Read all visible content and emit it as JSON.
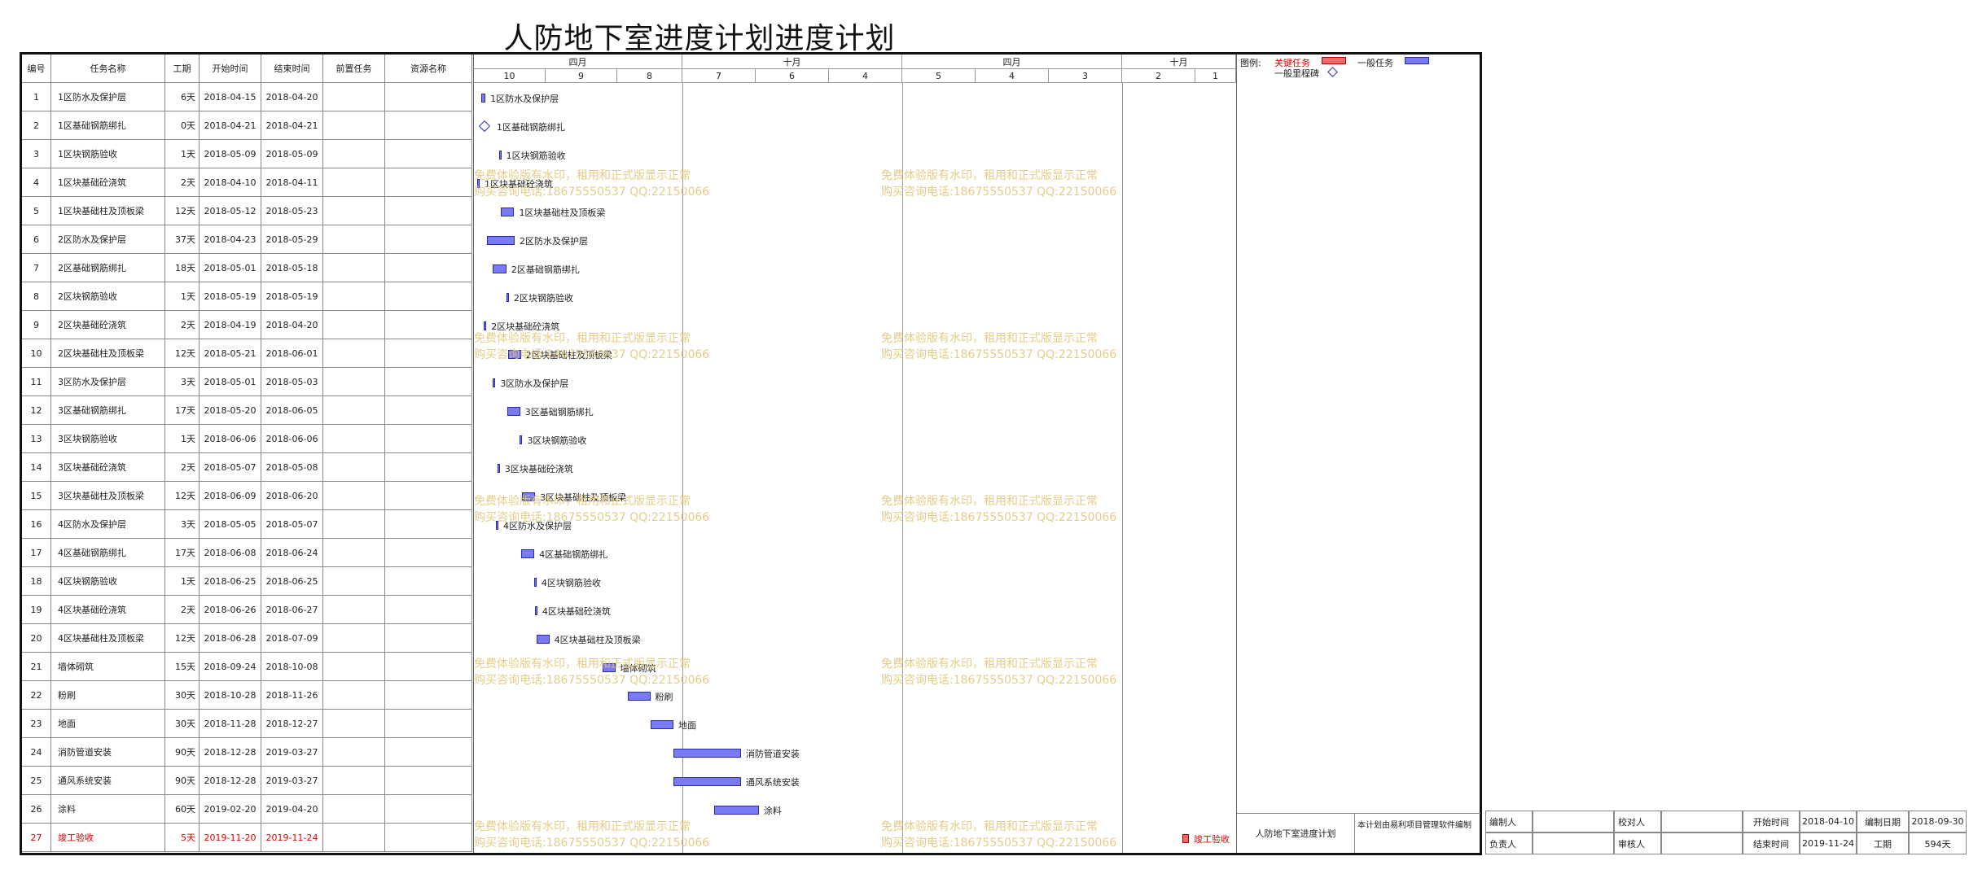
{
  "title": "人防地下室进度计划进度计划",
  "table": {
    "headers": {
      "id": "编号",
      "name": "任务名称",
      "duration": "工期",
      "start": "开始时间",
      "end": "结束时间",
      "predecessor": "前置任务",
      "resource": "资源名称"
    },
    "rows": [
      {
        "id": "1",
        "name": "1区防水及保护层",
        "duration": "6天",
        "start": "2018-04-15",
        "end": "2018-04-20"
      },
      {
        "id": "2",
        "name": "1区基础钢筋绑扎",
        "duration": "0天",
        "start": "2018-04-21",
        "end": "2018-04-21"
      },
      {
        "id": "3",
        "name": "1区块钢筋验收",
        "duration": "1天",
        "start": "2018-05-09",
        "end": "2018-05-09"
      },
      {
        "id": "4",
        "name": "1区块基础砼浇筑",
        "duration": "2天",
        "start": "2018-04-10",
        "end": "2018-04-11"
      },
      {
        "id": "5",
        "name": "1区块基础柱及顶板梁",
        "duration": "12天",
        "start": "2018-05-12",
        "end": "2018-05-23"
      },
      {
        "id": "6",
        "name": "2区防水及保护层",
        "duration": "37天",
        "start": "2018-04-23",
        "end": "2018-05-29"
      },
      {
        "id": "7",
        "name": "2区基础钢筋绑扎",
        "duration": "18天",
        "start": "2018-05-01",
        "end": "2018-05-18"
      },
      {
        "id": "8",
        "name": "2区块钢筋验收",
        "duration": "1天",
        "start": "2018-05-19",
        "end": "2018-05-19"
      },
      {
        "id": "9",
        "name": "2区块基础砼浇筑",
        "duration": "2天",
        "start": "2018-04-19",
        "end": "2018-04-20"
      },
      {
        "id": "10",
        "name": "2区块基础柱及顶板梁",
        "duration": "12天",
        "start": "2018-05-21",
        "end": "2018-06-01"
      },
      {
        "id": "11",
        "name": "3区防水及保护层",
        "duration": "3天",
        "start": "2018-05-01",
        "end": "2018-05-03"
      },
      {
        "id": "12",
        "name": "3区基础钢筋绑扎",
        "duration": "17天",
        "start": "2018-05-20",
        "end": "2018-06-05"
      },
      {
        "id": "13",
        "name": "3区块钢筋验收",
        "duration": "1天",
        "start": "2018-06-06",
        "end": "2018-06-06"
      },
      {
        "id": "14",
        "name": "3区块基础砼浇筑",
        "duration": "2天",
        "start": "2018-05-07",
        "end": "2018-05-08"
      },
      {
        "id": "15",
        "name": "3区块基础柱及顶板梁",
        "duration": "12天",
        "start": "2018-06-09",
        "end": "2018-06-20"
      },
      {
        "id": "16",
        "name": "4区防水及保护层",
        "duration": "3天",
        "start": "2018-05-05",
        "end": "2018-05-07"
      },
      {
        "id": "17",
        "name": "4区基础钢筋绑扎",
        "duration": "17天",
        "start": "2018-06-08",
        "end": "2018-06-24"
      },
      {
        "id": "18",
        "name": "4区块钢筋验收",
        "duration": "1天",
        "start": "2018-06-25",
        "end": "2018-06-25"
      },
      {
        "id": "19",
        "name": "4区块基础砼浇筑",
        "duration": "2天",
        "start": "2018-06-26",
        "end": "2018-06-27"
      },
      {
        "id": "20",
        "name": "4区块基础柱及顶板梁",
        "duration": "12天",
        "start": "2018-06-28",
        "end": "2018-07-09"
      },
      {
        "id": "21",
        "name": "墙体砌筑",
        "duration": "15天",
        "start": "2018-09-24",
        "end": "2018-10-08"
      },
      {
        "id": "22",
        "name": "粉刷",
        "duration": "30天",
        "start": "2018-10-28",
        "end": "2018-11-26"
      },
      {
        "id": "23",
        "name": "地面",
        "duration": "30天",
        "start": "2018-11-28",
        "end": "2018-12-27"
      },
      {
        "id": "24",
        "name": "消防管道安装",
        "duration": "90天",
        "start": "2018-12-28",
        "end": "2019-03-27"
      },
      {
        "id": "25",
        "name": "通风系统安装",
        "duration": "90天",
        "start": "2018-12-28",
        "end": "2019-03-27"
      },
      {
        "id": "26",
        "name": "涂料",
        "duration": "60天",
        "start": "2019-02-20",
        "end": "2019-04-20"
      },
      {
        "id": "27",
        "name": "竣工验收",
        "duration": "5天",
        "start": "2019-11-20",
        "end": "2019-11-24",
        "critical": true
      }
    ]
  },
  "timescale": {
    "top": [
      "四月",
      "十月",
      "四月",
      "十月"
    ],
    "bottom": [
      "10",
      "9",
      "8",
      "7",
      "6",
      "4",
      "5",
      "4",
      "3",
      "2",
      "1"
    ]
  },
  "legend": {
    "label": "图例:",
    "critical": "关键任务",
    "normal": "一般任务",
    "milestone": "一般里程碑"
  },
  "watermark": {
    "line1": "免费体验版有水印，租用和正式版显示正常",
    "line2": "购买咨询电话:18675550537 QQ:22150066"
  },
  "footer": {
    "plan_name": "人防地下室进度计划",
    "software_note": "本计划由易利项目管理软件编制"
  },
  "info": {
    "editor_label": "编制人",
    "editor_value": "",
    "checker_label": "校对人",
    "checker_value": "",
    "start_label": "开始时间",
    "start_value": "2018-04-10",
    "date_label": "编制日期",
    "date_value": "2018-09-30",
    "owner_label": "负责人",
    "owner_value": "",
    "reviewer_label": "审核人",
    "reviewer_value": "",
    "end_label": "结束时间",
    "end_value": "2019-11-24",
    "duration_label": "工期",
    "duration_value": "594天"
  },
  "colors": {
    "bar": "#7a7af5",
    "critical": "#f06a6a",
    "watermark": "#e3c77a",
    "critical_text": "#e00000"
  }
}
